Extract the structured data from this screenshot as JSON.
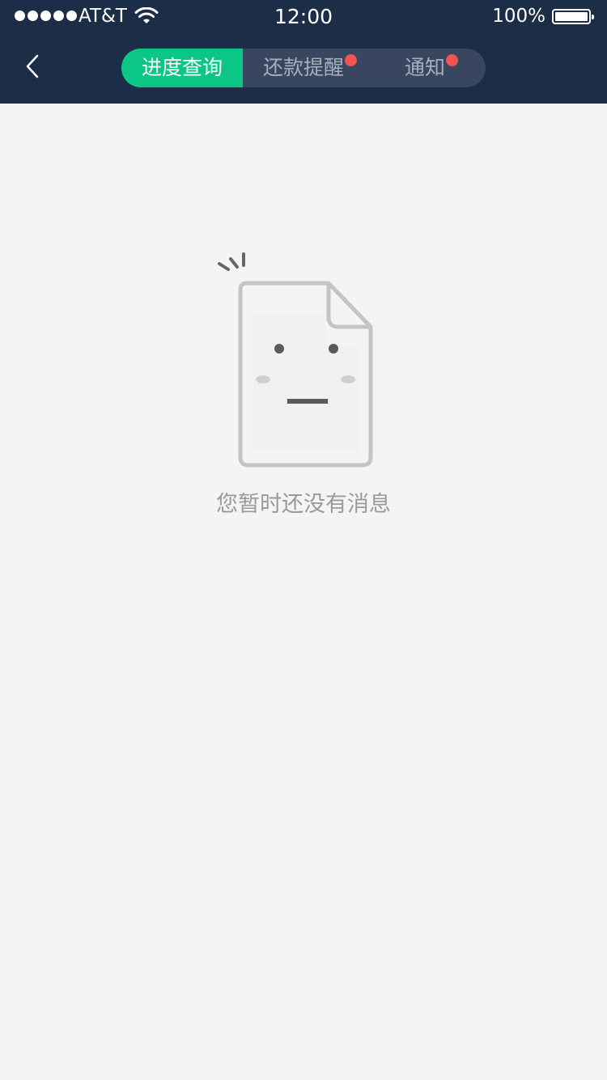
{
  "status_bar": {
    "carrier": "AT&T",
    "time": "12:00",
    "battery_percent": "100%"
  },
  "nav": {
    "tabs": [
      {
        "label": "进度查询",
        "active": true,
        "badge": false
      },
      {
        "label": "还款提醒",
        "active": false,
        "badge": true
      },
      {
        "label": "通知",
        "active": false,
        "badge": true
      }
    ]
  },
  "empty_state": {
    "message": "您暂时还没有消息"
  },
  "colors": {
    "header_bg": "#1c2d48",
    "active_tab": "#0bc684",
    "inactive_segment": "#38475f",
    "badge": "#f35353",
    "page_bg": "#f4f4f4"
  }
}
